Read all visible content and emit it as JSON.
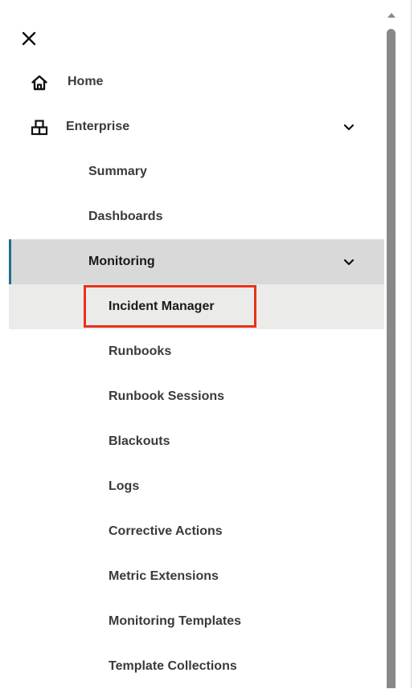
{
  "close_label": "close",
  "nav": {
    "home": {
      "label": "Home",
      "icon": "home-icon"
    },
    "enterprise": {
      "label": "Enterprise",
      "icon": "enterprise-icon",
      "expanded": true,
      "children": {
        "summary": "Summary",
        "dashboards": "Dashboards",
        "monitoring": {
          "label": "Monitoring",
          "expanded": true,
          "children": [
            "Incident Manager",
            "Runbooks",
            "Runbook Sessions",
            "Blackouts",
            "Logs",
            "Corrective Actions",
            "Metric Extensions",
            "Monitoring Templates",
            "Template Collections"
          ]
        }
      }
    }
  },
  "active_item": "Incident Manager",
  "colors": {
    "accent_bar": "#1f6f8e",
    "focus_outline": "#e8311a",
    "selected_parent_bg": "#d9d9d9",
    "active_bg": "#ebebea",
    "text": "#3a3a3a"
  }
}
